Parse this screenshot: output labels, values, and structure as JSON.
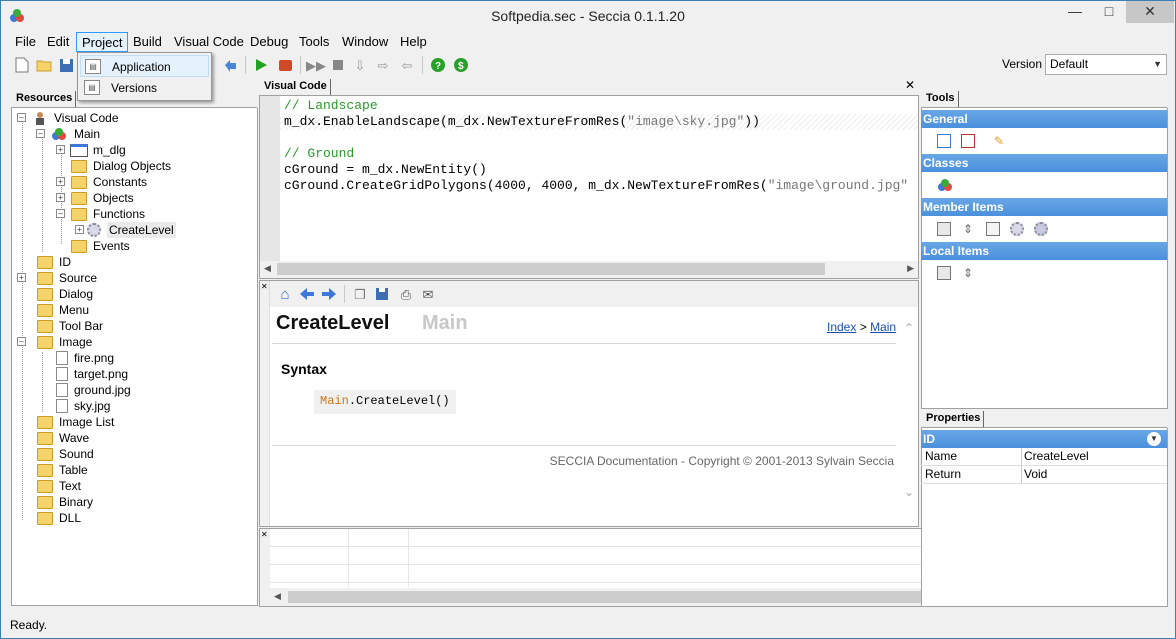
{
  "window": {
    "title": "Softpedia.sec - Seccia 0.1.1.20"
  },
  "menu": [
    "File",
    "Edit",
    "Project",
    "Build",
    "Visual Code",
    "Debug",
    "Tools",
    "Window",
    "Help"
  ],
  "project_menu": {
    "items": [
      "Application",
      "Versions"
    ]
  },
  "version": {
    "label": "Version",
    "selected": "Default"
  },
  "resources": {
    "tab": "Resources",
    "tree": {
      "visual_code": "Visual Code",
      "main": "Main",
      "m_dlg": "m_dlg",
      "dialog_objects": "Dialog Objects",
      "constants": "Constants",
      "objects": "Objects",
      "functions": "Functions",
      "createlevel": "CreateLevel",
      "events": "Events",
      "id": "ID",
      "source": "Source",
      "dialog": "Dialog",
      "menu": "Menu",
      "tool_bar": "Tool Bar",
      "image": "Image",
      "fire": "fire.png",
      "target": "target.png",
      "ground": "ground.jpg",
      "sky": "sky.jpg",
      "image_list": "Image List",
      "wave": "Wave",
      "sound": "Sound",
      "table": "Table",
      "text": "Text",
      "binary": "Binary",
      "dll": "DLL"
    }
  },
  "editor": {
    "tab": "Visual Code",
    "lines": [
      {
        "a": "// Landscape",
        "b": "",
        "c": ""
      },
      {
        "a": "m_dx.EnableLandscape(m_dx.NewTextureFromRes(",
        "b": "\"image\\sky.jpg\"",
        "c": "))"
      },
      {
        "a": "",
        "b": "",
        "c": ""
      },
      {
        "a": "// Ground",
        "b": "",
        "c": ""
      },
      {
        "a": "cGround = m_dx.NewEntity()",
        "b": "",
        "c": ""
      },
      {
        "a": "cGround.CreateGridPolygons(4000, 4000, m_dx.NewTextureFromRes(",
        "b": "\"image\\ground.jpg\"",
        "c": ""
      }
    ]
  },
  "doc": {
    "title": "CreateLevel",
    "parent": "Main",
    "nav_index": "Index",
    "nav_sep": ">",
    "nav_main": "Main",
    "syntax_heading": "Syntax",
    "syntax_obj": "Main",
    "syntax_call": ".CreateLevel()",
    "footer": "SECCIA Documentation - Copyright © 2001-2013 Sylvain Seccia"
  },
  "tools": {
    "tab": "Tools",
    "sections": [
      "General",
      "Classes",
      "Member Items",
      "Local Items"
    ]
  },
  "properties": {
    "tab": "Properties",
    "header": "ID",
    "rows": [
      {
        "key": "Name",
        "value": "CreateLevel"
      },
      {
        "key": "Return",
        "value": "Void"
      }
    ]
  },
  "status": {
    "text": "Ready."
  }
}
